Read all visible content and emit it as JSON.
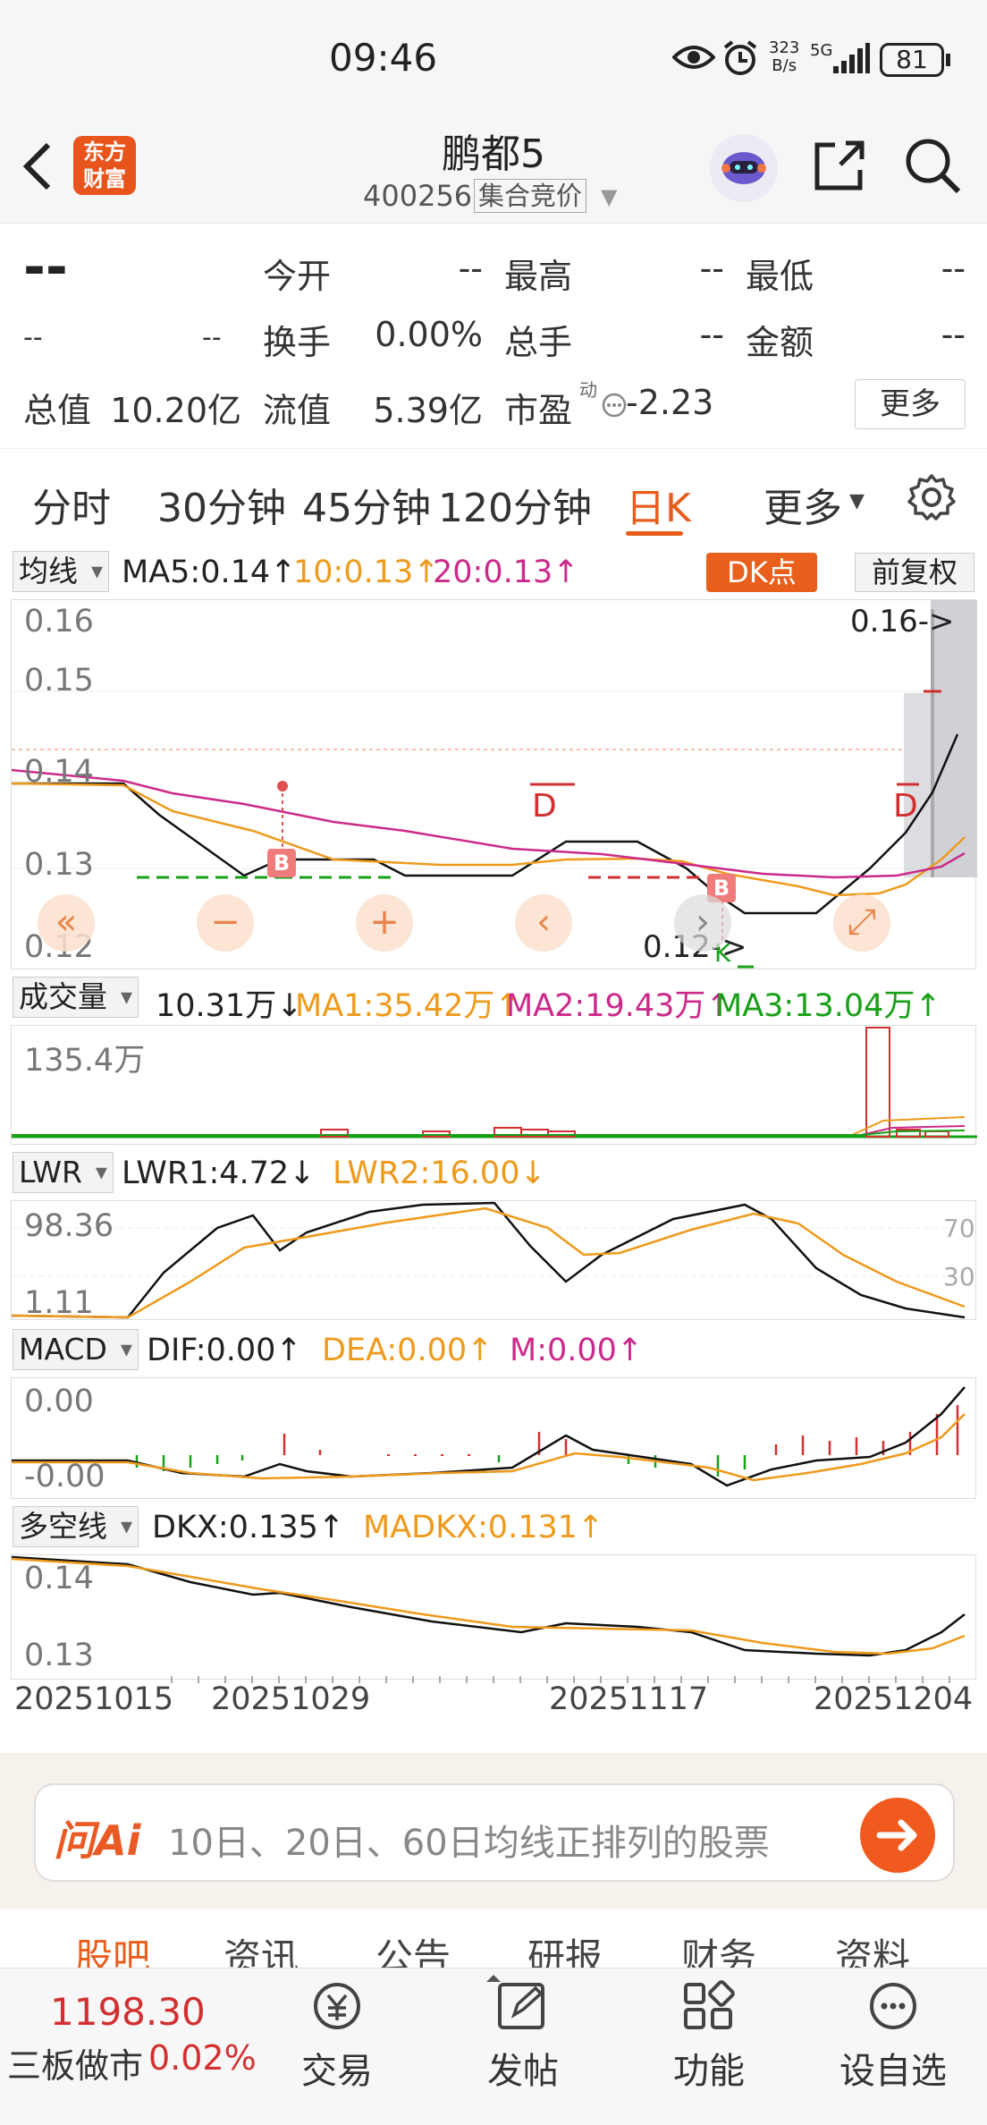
{
  "status_bar": {
    "time": "09:46",
    "net_speed_top": "323",
    "net_speed_bottom": "B/s",
    "signal": "5G",
    "battery": "81"
  },
  "nav": {
    "title": "鹏都5",
    "code": "400256",
    "mode": "集合竞价",
    "logo_line1": "东方",
    "logo_line2": "财富"
  },
  "quote": {
    "price": "--",
    "change1": "--",
    "change2": "--",
    "today_open_label": "今开",
    "today_open": "--",
    "high_label": "最高",
    "high": "--",
    "low_label": "最低",
    "low": "--",
    "turnover_label": "换手",
    "turnover": "0.00%",
    "volume_label": "总手",
    "volume": "--",
    "amount_label": "金额",
    "amount": "--",
    "total_value_label": "总值",
    "total_value": "10.20亿",
    "float_value_label": "流值",
    "float_value": "5.39亿",
    "pe_label": "市盈",
    "pe_sup": "动",
    "pe": "-2.23",
    "more": "更多"
  },
  "tabs": [
    "分时",
    "30分钟",
    "45分钟",
    "120分钟",
    "日K",
    "更多"
  ],
  "active_tab": "日K",
  "ma_bar": {
    "select": "均线",
    "ma5": "MA5:0.14↑",
    "ma10": "10:0.13↑",
    "ma20": "20:0.13↑",
    "dk_button": "DK点",
    "fq_button": "前复权"
  },
  "kline": {
    "y_labels": [
      "0.16",
      "0.15",
      "0.14",
      "0.13",
      "0.12"
    ],
    "high_marker": "0.16->",
    "low_marker": "0.12->",
    "signal_b": "B",
    "signal_d": "D",
    "signal_k": "K"
  },
  "volume_bar": {
    "select": "成交量",
    "value": "10.31万↓",
    "ma1": "MA1:35.42万↑",
    "ma2": "MA2:19.43万↑",
    "ma3": "MA3:13.04万↑",
    "y_label": "135.4万"
  },
  "lwr_bar": {
    "select": "LWR",
    "lwr1": "LWR1:4.72↓",
    "lwr2": "LWR2:16.00↓",
    "y_top": "98.36",
    "y_bottom": "1.11",
    "ref70": "70",
    "ref30": "30"
  },
  "macd_bar": {
    "select": "MACD",
    "dif": "DIF:0.00↑",
    "dea": "DEA:0.00↑",
    "m": "M:0.00↑",
    "y_top": "0.00",
    "y_bottom": "-0.00"
  },
  "dkx_bar": {
    "select": "多空线",
    "dkx": "DKX:0.135↑",
    "madkx": "MADKX:0.131↑",
    "y_top": "0.14",
    "y_bottom": "0.13"
  },
  "dates": [
    "20251015",
    "20251029",
    "20251117",
    "20251204"
  ],
  "ai": {
    "logo": "问Ai",
    "placeholder": "10日、20日、60日均线正排列的股票"
  },
  "sub_tabs": [
    "股吧",
    "资讯",
    "公告",
    "研报",
    "财务",
    "资料"
  ],
  "bottom_bar": {
    "index_value": "1198.30",
    "index_name": "三板做市",
    "index_change": "0.02%",
    "trade": "交易",
    "post": "发帖",
    "func": "功能",
    "watch": "设自选"
  },
  "colors": {
    "accent": "#e85d1c",
    "red": "#d23030",
    "green": "#18a018",
    "ma10": "#ee9a1c",
    "ma20": "#cc2a8a",
    "black": "#111111"
  }
}
